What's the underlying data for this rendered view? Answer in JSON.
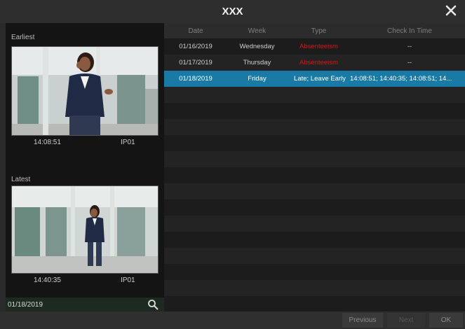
{
  "window": {
    "title": "XXX"
  },
  "left_panel": {
    "earliest_label": "Earliest",
    "earliest_time": "14:08:51",
    "earliest_camera": "IP01",
    "latest_label": "Latest",
    "latest_time": "14:40:35",
    "latest_camera": "IP01",
    "date_value": "01/18/2019"
  },
  "table": {
    "headers": [
      "Date",
      "Week",
      "Type",
      "Check In Time"
    ],
    "rows": [
      {
        "date": "01/16/2019",
        "week": "Wednesday",
        "type": "Absenteeism",
        "checkin": "--"
      },
      {
        "date": "01/17/2019",
        "week": "Thursday",
        "type": "Absenteeism",
        "checkin": "--"
      },
      {
        "date": "01/18/2019",
        "week": "Friday",
        "type": "Late; Leave Early",
        "checkin": "14:08:51; 14:40:35; 14:08:51; 14..."
      }
    ]
  },
  "buttons": {
    "previous": "Previous",
    "next": "Next",
    "ok": "OK"
  },
  "colors": {
    "selected_row": "#1a7aa6",
    "absent": "#d81818"
  }
}
